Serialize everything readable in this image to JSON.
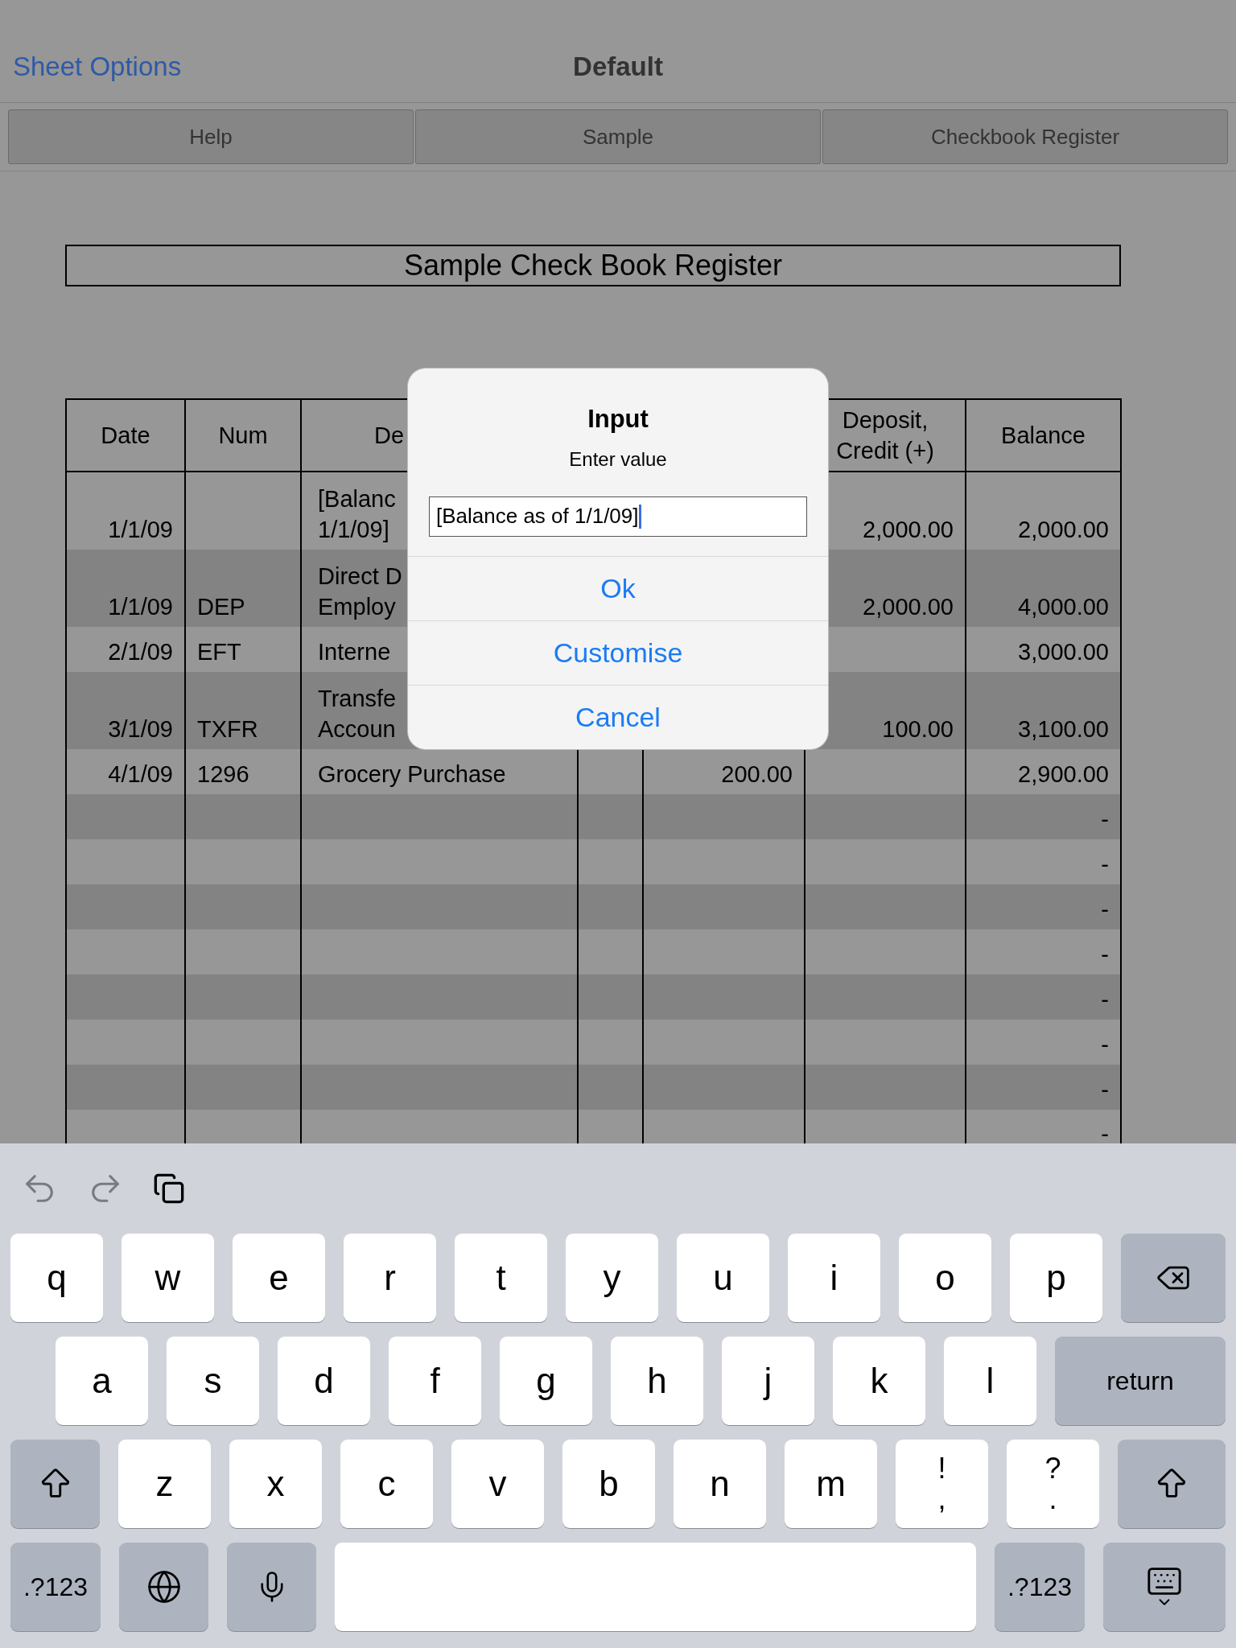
{
  "nav": {
    "link": "Sheet Options",
    "title": "Default"
  },
  "segments": [
    {
      "label": "Help"
    },
    {
      "label": "Sample"
    },
    {
      "label": "Checkbook Register"
    }
  ],
  "sheet": {
    "title": "Sample Check Book Register",
    "columns": [
      {
        "label": "Date"
      },
      {
        "label": "Num"
      },
      {
        "label": "De"
      },
      {},
      {},
      {
        "label": "Deposit, Credit (+)"
      },
      {
        "label": "Balance"
      }
    ],
    "rows": [
      {
        "date": "1/1/09",
        "description": [
          "[Balanc",
          "1/1/09]"
        ],
        "deposit": "2,000.00",
        "balance": "2,000.00"
      },
      {
        "date": "1/1/09",
        "num": "DEP",
        "description": [
          "Direct D",
          "Employ"
        ],
        "deposit": "2,000.00",
        "balance": "4,000.00"
      },
      {
        "date": "2/1/09",
        "num": "EFT",
        "description": [
          "Interne"
        ],
        "balance": "3,000.00"
      },
      {
        "date": "3/1/09",
        "num": "TXFR",
        "description": [
          "Transfe",
          "Accoun"
        ],
        "deposit": "100.00",
        "balance": "3,100.00"
      },
      {
        "date": "4/1/09",
        "num": "1296",
        "description": [
          "Grocery Purchase"
        ],
        "withdrawal": "200.00",
        "balance": "2,900.00"
      },
      {
        "balance": "-"
      },
      {
        "balance": "-"
      },
      {
        "balance": "-"
      },
      {
        "balance": "-"
      },
      {
        "balance": "-"
      },
      {
        "balance": "-"
      },
      {
        "balance": "-"
      },
      {
        "balance": "-"
      }
    ]
  },
  "dialog": {
    "title": "Input",
    "message": "Enter value",
    "input": {
      "value": "[Balance as of 1/1/09]"
    },
    "buttons": [
      "Ok",
      "Customise",
      "Cancel"
    ]
  },
  "keyboard": {
    "key_rows": [
      {
        "keys": [
          {
            "kind": "letter",
            "label": "q"
          },
          {
            "kind": "letter",
            "label": "w"
          },
          {
            "kind": "letter",
            "label": "e"
          },
          {
            "kind": "letter",
            "label": "r"
          },
          {
            "kind": "letter",
            "label": "t"
          },
          {
            "kind": "letter",
            "label": "y"
          },
          {
            "kind": "letter",
            "label": "u"
          },
          {
            "kind": "letter",
            "label": "i"
          },
          {
            "kind": "letter",
            "label": "o"
          },
          {
            "kind": "letter",
            "label": "p"
          },
          {
            "kind": "backspace"
          }
        ]
      },
      {
        "keys": [
          {
            "kind": "letter",
            "label": "a"
          },
          {
            "kind": "letter",
            "label": "s"
          },
          {
            "kind": "letter",
            "label": "d"
          },
          {
            "kind": "letter",
            "label": "f"
          },
          {
            "kind": "letter",
            "label": "g"
          },
          {
            "kind": "letter",
            "label": "h"
          },
          {
            "kind": "letter",
            "label": "j"
          },
          {
            "kind": "letter",
            "label": "k"
          },
          {
            "kind": "letter",
            "label": "l"
          },
          {
            "kind": "return",
            "label": "return"
          }
        ]
      },
      {
        "keys": [
          {
            "kind": "shift"
          },
          {
            "kind": "letter",
            "label": "z"
          },
          {
            "kind": "letter",
            "label": "x"
          },
          {
            "kind": "letter",
            "label": "c"
          },
          {
            "kind": "letter",
            "label": "v"
          },
          {
            "kind": "letter",
            "label": "b"
          },
          {
            "kind": "letter",
            "label": "n"
          },
          {
            "kind": "letter",
            "label": "m"
          },
          {
            "kind": "dual",
            "label": "!",
            "sublabel": ","
          },
          {
            "kind": "dual",
            "label": "?",
            "sublabel": "."
          },
          {
            "kind": "shift"
          }
        ]
      },
      {
        "keys": [
          {
            "kind": "mode",
            "label": ".?123"
          },
          {
            "kind": "globe"
          },
          {
            "kind": "mic"
          },
          {
            "kind": "space"
          },
          {
            "kind": "mode",
            "label": ".?123"
          },
          {
            "kind": "hide"
          }
        ]
      }
    ]
  }
}
